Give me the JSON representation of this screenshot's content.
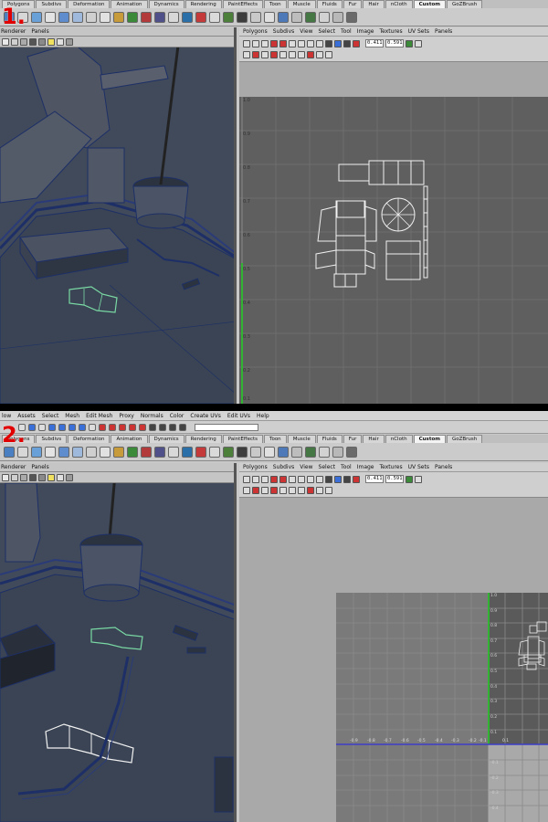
{
  "steps": [
    "1.",
    "2."
  ],
  "main_menu": {
    "items": [
      "low",
      "Assets",
      "Select",
      "Mesh",
      "Edit Mesh",
      "Proxy",
      "Normals",
      "Color",
      "Create UVs",
      "Edit UVs",
      "Help"
    ]
  },
  "shelf": {
    "tabs": [
      "Polygons",
      "Subdivs",
      "Deformation",
      "Animation",
      "Dynamics",
      "Rendering",
      "PaintEffects",
      "Toon",
      "Muscle",
      "Fluids",
      "Fur",
      "Hair",
      "nCloth",
      "Custom",
      "GoZBrush"
    ],
    "active_tab": "Custom"
  },
  "viewport_menu": {
    "items": [
      "Renderer",
      "Panels"
    ]
  },
  "uv_editor": {
    "menu": [
      "Polygons",
      "Subdivs",
      "View",
      "Select",
      "Tool",
      "Image",
      "Textures",
      "UV Sets",
      "Panels"
    ],
    "u_value": "0.411",
    "v_value": "0.591",
    "axis_ticks_vertical": [
      "1.0",
      "0.9",
      "0.8",
      "0.7",
      "0.6",
      "0.5",
      "0.4",
      "0.3",
      "0.2",
      "0.1"
    ],
    "axis_ticks_horizontal": [
      "-0.9",
      "-0.8",
      "-0.7",
      "-0.6",
      "-0.5",
      "-0.4",
      "-0.3",
      "-0.2",
      "-0.1"
    ],
    "axis_ticks_vertical_neg": [
      "-0.1",
      "-0.2",
      "-0.3",
      "-0.4"
    ],
    "tick_x_origin": "0.1",
    "panel2_ticks_vertical": [
      "1.0",
      "0.9",
      "0.8",
      "0.7",
      "0.6",
      "0.5",
      "0.4",
      "0.3",
      "0.2",
      "0.1"
    ]
  },
  "colors": {
    "uv_grid_bg": "#5f5f5f",
    "uv_grid_line": "#6d6d6d",
    "uv_shell": "#f2f2f2",
    "v_axis": "#32b432",
    "u_axis": "#3c3cc8",
    "viewport_bg": "#3f4a5a",
    "wire": "#1d2f66",
    "selected_shell": "#7ad9a4",
    "step_number": "#e00000"
  }
}
